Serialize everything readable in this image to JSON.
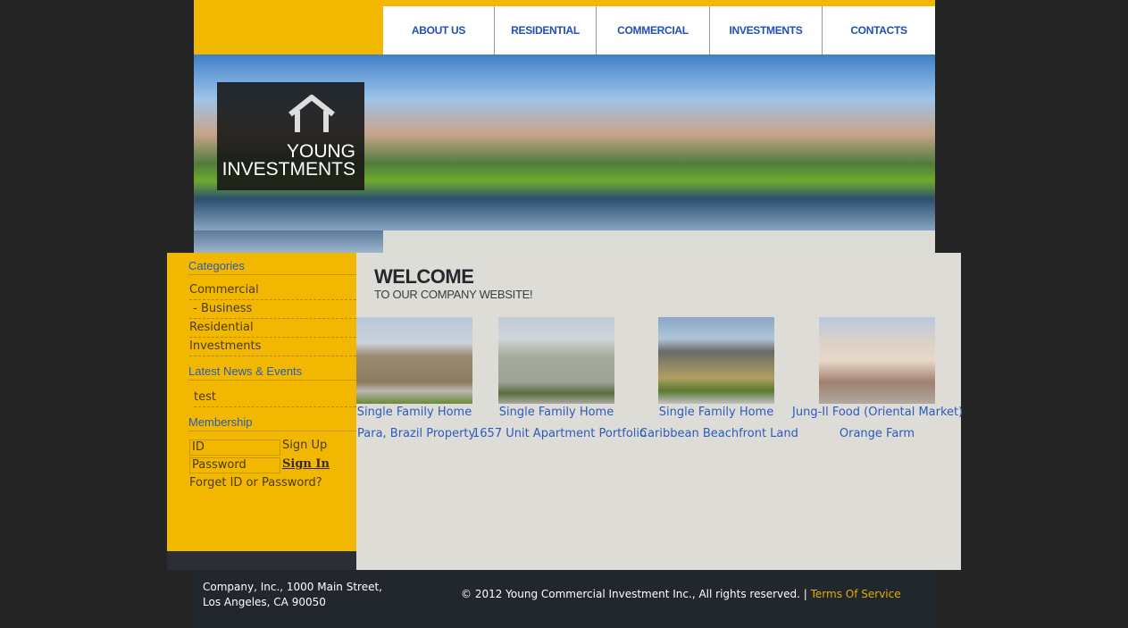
{
  "nav": {
    "items": [
      "ABOUT US",
      "RESIDENTIAL",
      "COMMERCIAL",
      "INVESTMENTS",
      "CONTACTS"
    ]
  },
  "logo": {
    "line1": "YOUNG",
    "line2": "INVESTMENTS"
  },
  "sidebar": {
    "categories_title": "Categories",
    "categories": [
      "Commercial",
      " - Business",
      "Residential",
      "Investments"
    ],
    "news_title": "Latest News & Events",
    "news": [
      "test"
    ],
    "membership_title": "Membership",
    "id_placeholder": "ID",
    "password_placeholder": "Password",
    "sign_up": "Sign Up",
    "sign_in": "Sign In",
    "forgot": "Forget ID or Password?"
  },
  "main": {
    "title": "WELCOME",
    "subtitle": "TO OUR COMPANY WEBSITE!",
    "listings": [
      "Single Family Home",
      "Single Family Home",
      "Single Family Home",
      "Jung-Il Food (Oriental Market)"
    ],
    "more_listings": [
      "Para, Brazil Property",
      "1657 Unit Apartment Portfolio",
      "Caribbean Beachfront Land",
      "Orange Farm"
    ]
  },
  "footer": {
    "address_line1": "Company, Inc., 1000 Main Street,",
    "address_line2": "Los Angeles, CA 90050",
    "copyright": "© 2012 Young Commercial Investment Inc., All rights reserved. |",
    "terms": "Terms Of Service"
  },
  "colors": {
    "brand_yellow": "#f2b700",
    "link_blue": "#2a5bc0",
    "content_bg": "#dddcd6",
    "footer_bg": "#22272d"
  }
}
